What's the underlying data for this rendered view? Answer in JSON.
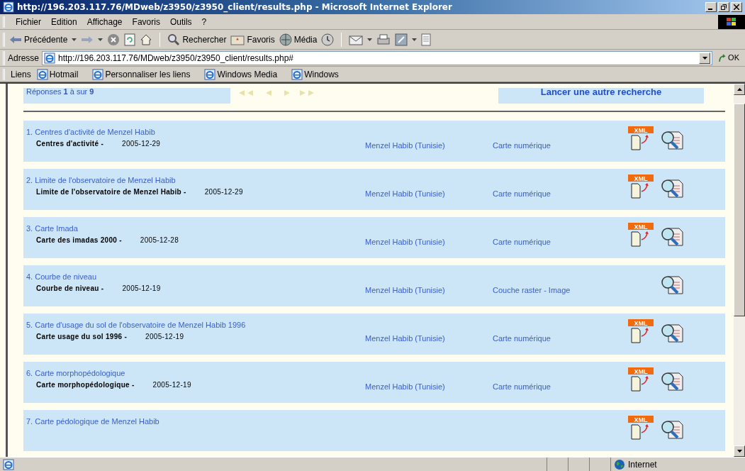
{
  "window": {
    "title": "http://196.203.117.76/MDweb/z3950/z3950_client/results.php - Microsoft Internet Explorer"
  },
  "menu": [
    "Fichier",
    "Edition",
    "Affichage",
    "Favoris",
    "Outils",
    "?"
  ],
  "toolbar": [
    {
      "kind": "back",
      "label": "Précédente"
    },
    {
      "kind": "caret"
    },
    {
      "kind": "forward"
    },
    {
      "kind": "caret"
    },
    {
      "kind": "stop"
    },
    {
      "kind": "refresh"
    },
    {
      "kind": "home"
    },
    {
      "kind": "separator"
    },
    {
      "kind": "search",
      "label": "Rechercher"
    },
    {
      "kind": "favorites",
      "label": "Favoris"
    },
    {
      "kind": "media",
      "label": "Média"
    },
    {
      "kind": "history"
    },
    {
      "kind": "separator"
    },
    {
      "kind": "mail"
    },
    {
      "kind": "caret"
    },
    {
      "kind": "print"
    },
    {
      "kind": "edit"
    },
    {
      "kind": "caret"
    },
    {
      "kind": "discuss"
    }
  ],
  "address": {
    "label": "Adresse",
    "value": "http://196.203.117.76/MDweb/z3950/z3950_client/results.php#",
    "go": "OK"
  },
  "links": {
    "label": "Liens",
    "items": [
      "Hotmail",
      "Personnaliser les liens",
      "Windows Media",
      "Windows"
    ]
  },
  "results_header": {
    "count": "Réponses **1** à sur **9**",
    "new_search": "Lancer une autre recherche"
  },
  "results": [
    {
      "title": "1. Centres d'activité de Menzel Habib",
      "description": "Centres d'activité -",
      "date": "2005-12-29",
      "location": "Menzel Habib (Tunisie)",
      "type": "Carte numérique",
      "xml_badge": "XML"
    },
    {
      "title": "2. Limite de l'observatoire de Menzel Habib",
      "description": "Limite de l'observatoire de Menzel Habib -",
      "date": "2005-12-29",
      "location": "Menzel Habib (Tunisie)",
      "type": "Carte numérique",
      "xml_badge": "XML"
    },
    {
      "title": "3. Carte Imada",
      "description": "Carte des imadas 2000 -",
      "date": "2005-12-28",
      "location": "Menzel Habib (Tunisie)",
      "type": "Carte numérique",
      "xml_badge": "XML"
    },
    {
      "title": "4. Courbe de niveau",
      "description": "Courbe de niveau -",
      "date": "2005-12-19",
      "location": "Menzel Habib (Tunisie)",
      "type": "Couche raster - Image"
    },
    {
      "title": "5. Carte d'usage du sol de l'observatoire de Menzel Habib 1996",
      "description": "Carte usage du sol 1996 -",
      "date": "2005-12-19",
      "location": "Menzel Habib (Tunisie)",
      "type": "Carte numérique",
      "xml_badge": "XML"
    },
    {
      "title": "6. Carte morphopédologique",
      "description": "Carte morphopédologique -",
      "date": "2005-12-19",
      "location": "Menzel Habib (Tunisie)",
      "type": "Carte numérique",
      "xml_badge": "XML"
    },
    {
      "title": "7. Carte pédologique de Menzel Habib",
      "xml_badge": "XML"
    }
  ],
  "status_bar": {
    "zone": "Internet"
  }
}
